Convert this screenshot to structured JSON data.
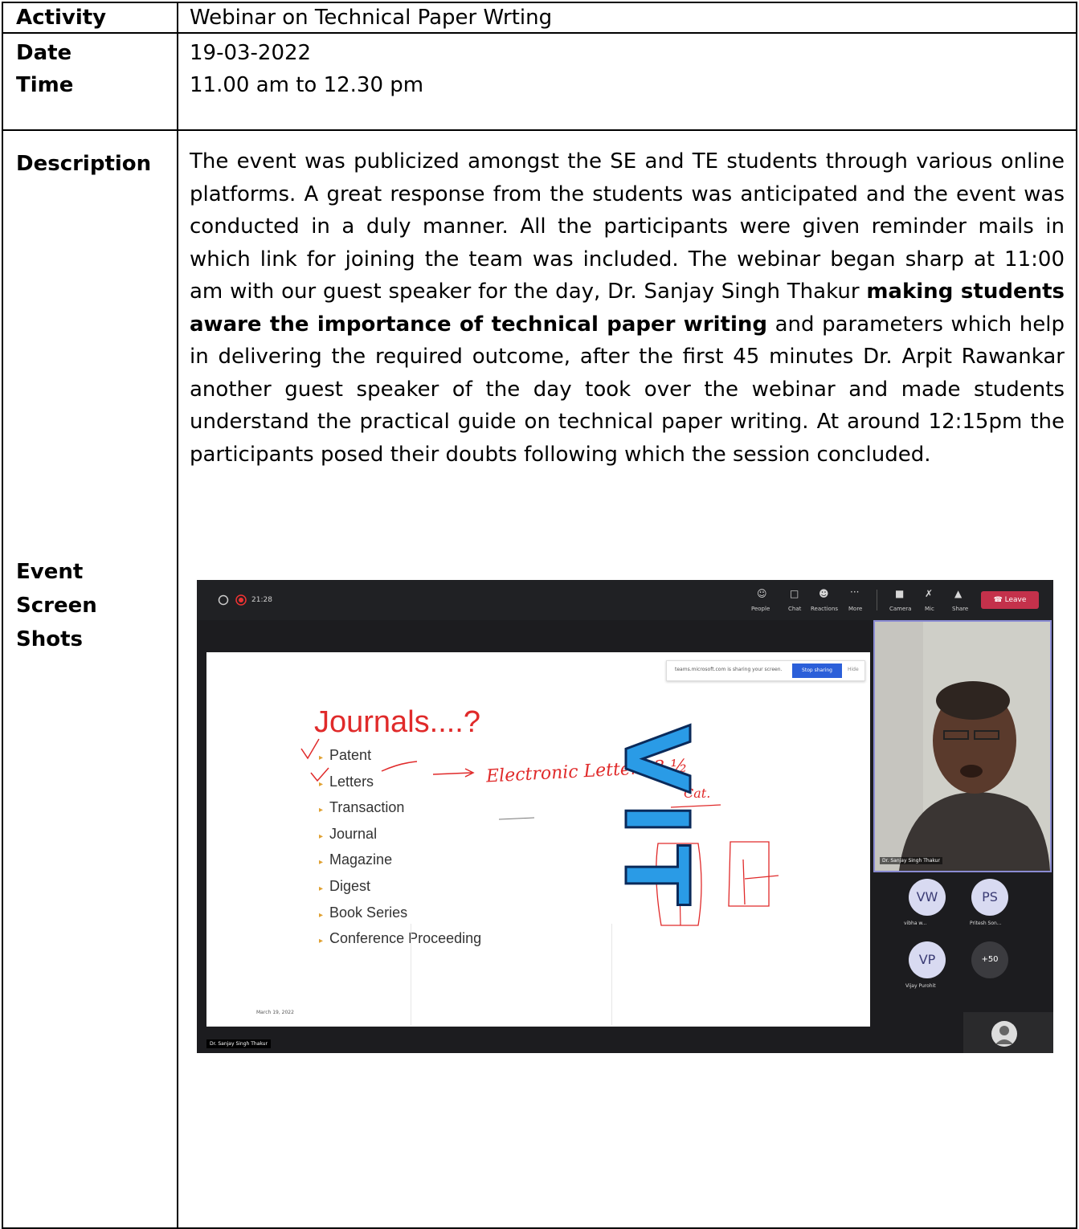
{
  "rows": {
    "activity_label": "Activity",
    "activity_value": "Webinar on Technical Paper Wrting",
    "date_label": "Date",
    "date_value": "19-03-2022",
    "time_label": "Time",
    "time_value": "11.00 am to 12.30 pm",
    "description_label": "Description",
    "description_part1": "The event was publicized amongst the SE and TE students through various online platforms. A great response from the students was anticipated and the event was conducted in a duly manner. All the participants were given reminder mails in which link for joining the team was included. The webinar began sharp at 11:00 am with our guest speaker for the day, Dr. Sanjay Singh Thakur ",
    "description_bold": "making students aware the importance of technical paper writing",
    "description_part2": " and parameters which help in delivering the required outcome, after the first 45 minutes Dr. Arpit Rawankar another guest speaker of the day took over the webinar and made students understand the practical guide on technical paper writing. At around 12:15pm the participants posed their doubts following which the session concluded.",
    "screenshots_label_line1": "Event",
    "screenshots_label_line2": "Screen",
    "screenshots_label_line3": "Shots"
  },
  "screenshot": {
    "meeting_time": "21:28",
    "toolbar": {
      "people": "People",
      "chat": "Chat",
      "reactions": "Reactions",
      "more": "More",
      "camera": "Camera",
      "mic": "Mic",
      "share": "Share",
      "leave": "Leave"
    },
    "share_notice": "teams.microsoft.com is sharing your screen.",
    "stop_sharing": "Stop sharing",
    "hide": "Hide",
    "slide": {
      "title": "Journals....?",
      "items": [
        "Patent",
        "Letters",
        "Transaction",
        "Journal",
        "Magazine",
        "Digest",
        "Book Series",
        "Conference Proceeding"
      ],
      "date": "March 19, 2022",
      "logo_text": "VIT",
      "annotation_line1": "Electronic Letters 3 ½",
      "annotation_line2": "Cat."
    },
    "video_name": "Dr. Sanjay Singh Thakur",
    "participants": [
      {
        "initials": "VW",
        "name": "vibha w..."
      },
      {
        "initials": "PS",
        "name": "Pritesh Son..."
      },
      {
        "initials": "VP",
        "name": "Vijay Purohit"
      },
      {
        "initials": "+50",
        "name": ""
      }
    ],
    "presenter_label": "Dr. Sanjay Singh Thakur"
  }
}
